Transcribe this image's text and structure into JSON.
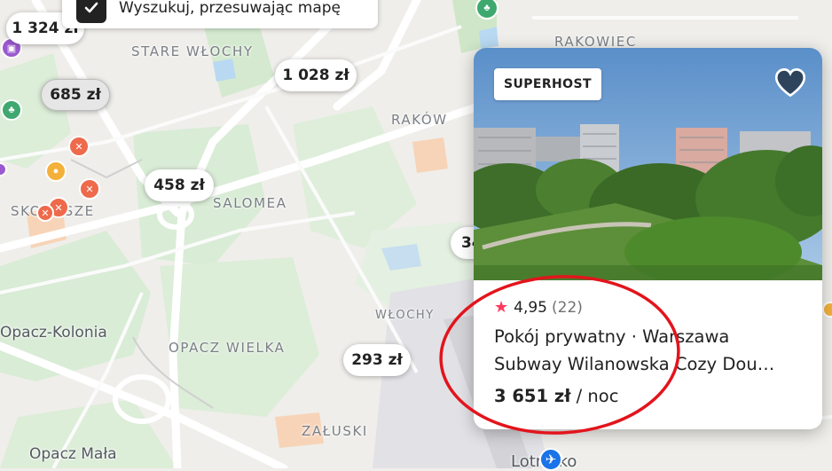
{
  "filter": {
    "label": "Wyszukuj, przesuwając mapę"
  },
  "map_labels": {
    "stare_wlochy": "STARE WŁOCHY",
    "rakowiec": "RAKOWIEC",
    "rakow": "RAKÓW",
    "salomea": "SALOMEA",
    "skorosze": "SKOROSZE",
    "wlochy": "WŁOCHY",
    "opacz_kolonia": "Opacz-Kolonia",
    "opacz_wielka": "OPACZ WIELKA",
    "zaluski": "ZAŁUSKI",
    "opacz_mala": "Opacz Mała",
    "lotnisko": "Lotnisko"
  },
  "price_pins": [
    {
      "label": "1 324 zł"
    },
    {
      "label": "1 028 zł"
    },
    {
      "label": "685 zł"
    },
    {
      "label": "458 zł"
    },
    {
      "label": "293 zł"
    },
    {
      "label": "34"
    }
  ],
  "card": {
    "badge": "SUPERHOST",
    "rating": "4,95",
    "review_count": "(22)",
    "title_line1": "Pokój prywatny · Warszawa",
    "title_line2": "Subway Wilanowska Cozy Dou…",
    "price": "3 651 zł",
    "price_unit": " / noc",
    "photo_count": 5,
    "active_photo": 1
  },
  "colors": {
    "accent_star": "#ff385c",
    "annotation_circle": "#e3141c",
    "poi_food": "#ee6a4b",
    "poi_park": "#3fa86f",
    "poi_shop": "#9b59d0",
    "poi_amusement": "#f4b13a",
    "airport": "#1a73e8"
  }
}
